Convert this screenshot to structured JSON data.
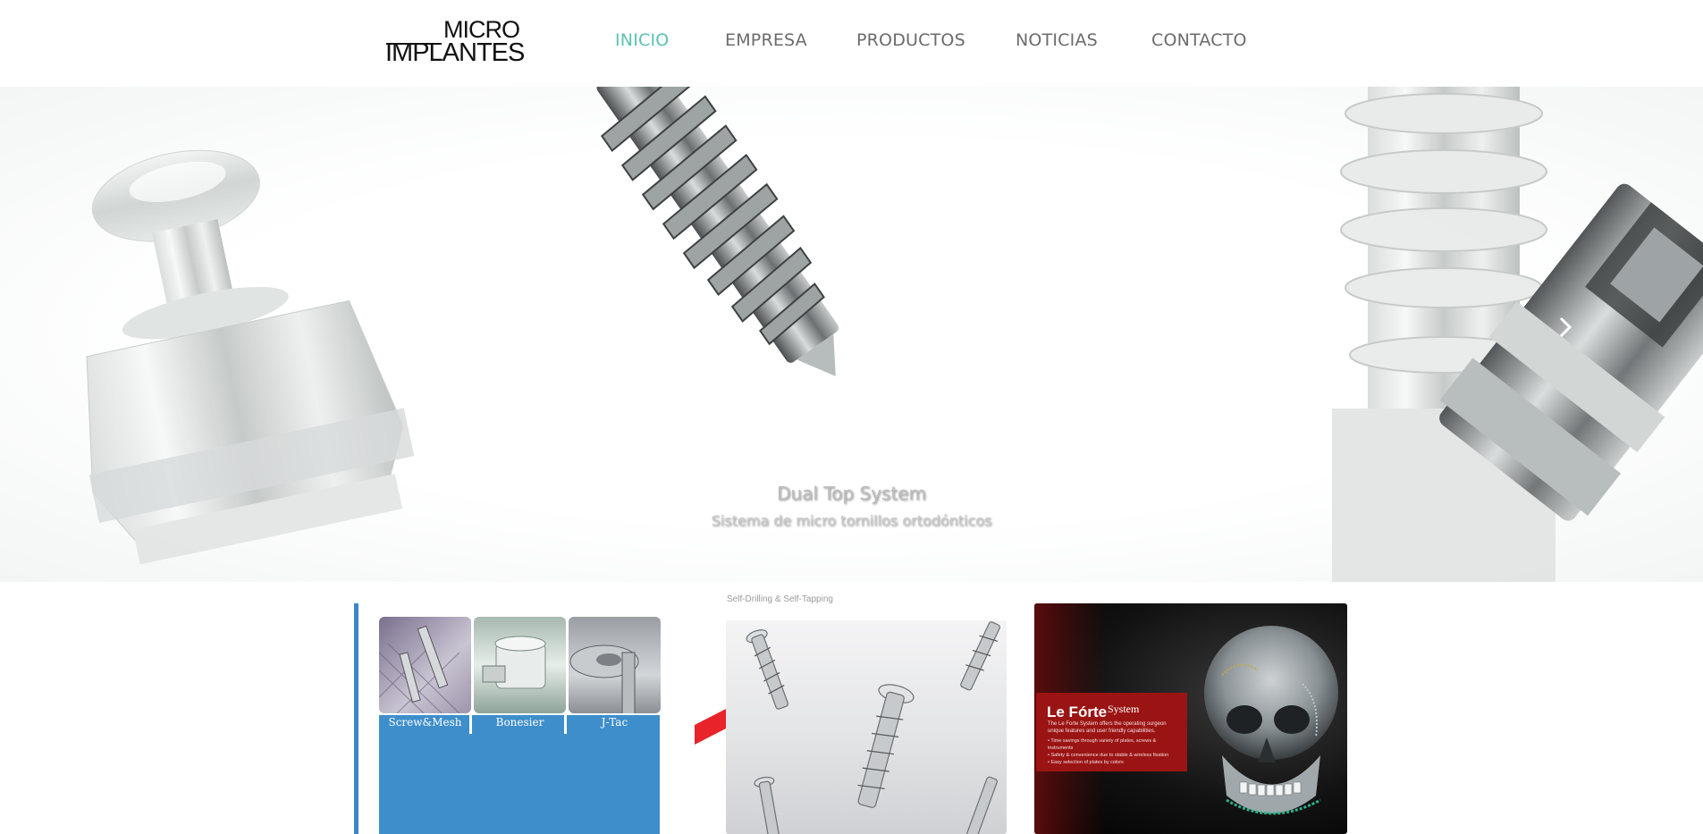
{
  "header": {
    "logo": {
      "top": "MICRO",
      "bottom": "IMPLANTES"
    },
    "nav": [
      {
        "label": "INICIO",
        "active": true
      },
      {
        "label": "EMPRESA",
        "active": false
      },
      {
        "label": "PRODUCTOS",
        "active": false
      },
      {
        "label": "NOTICIAS",
        "active": false
      },
      {
        "label": "CONTACTO",
        "active": false
      }
    ]
  },
  "hero": {
    "title": "Dual Top System",
    "subtitle": "Sistema de micro tornillos ortodónticos",
    "next_icon": "chevron-right-icon"
  },
  "cards": {
    "card1": {
      "labels": [
        "Screw&Mesh",
        "Bonesier",
        "J-Tac"
      ]
    },
    "card2": {
      "caption": "Self-Drilling & Self-Tapping"
    },
    "card3": {
      "title": "Le Fórte",
      "title_suffix": "System",
      "description": "The Le Forte System offers the operating surgeon unique features and user friendly capabilities.",
      "bullets": [
        "• Time savings through variety of plates, screws & instruments",
        "• Safety & convenience due to stable & wireless fixation",
        "• Easy selection of plates by colors"
      ]
    }
  },
  "colors": {
    "accent": "#5cc2b4",
    "nav_text": "#6b6b6b",
    "card_blue": "#3e8ecb",
    "card_red": "#9b1414"
  }
}
